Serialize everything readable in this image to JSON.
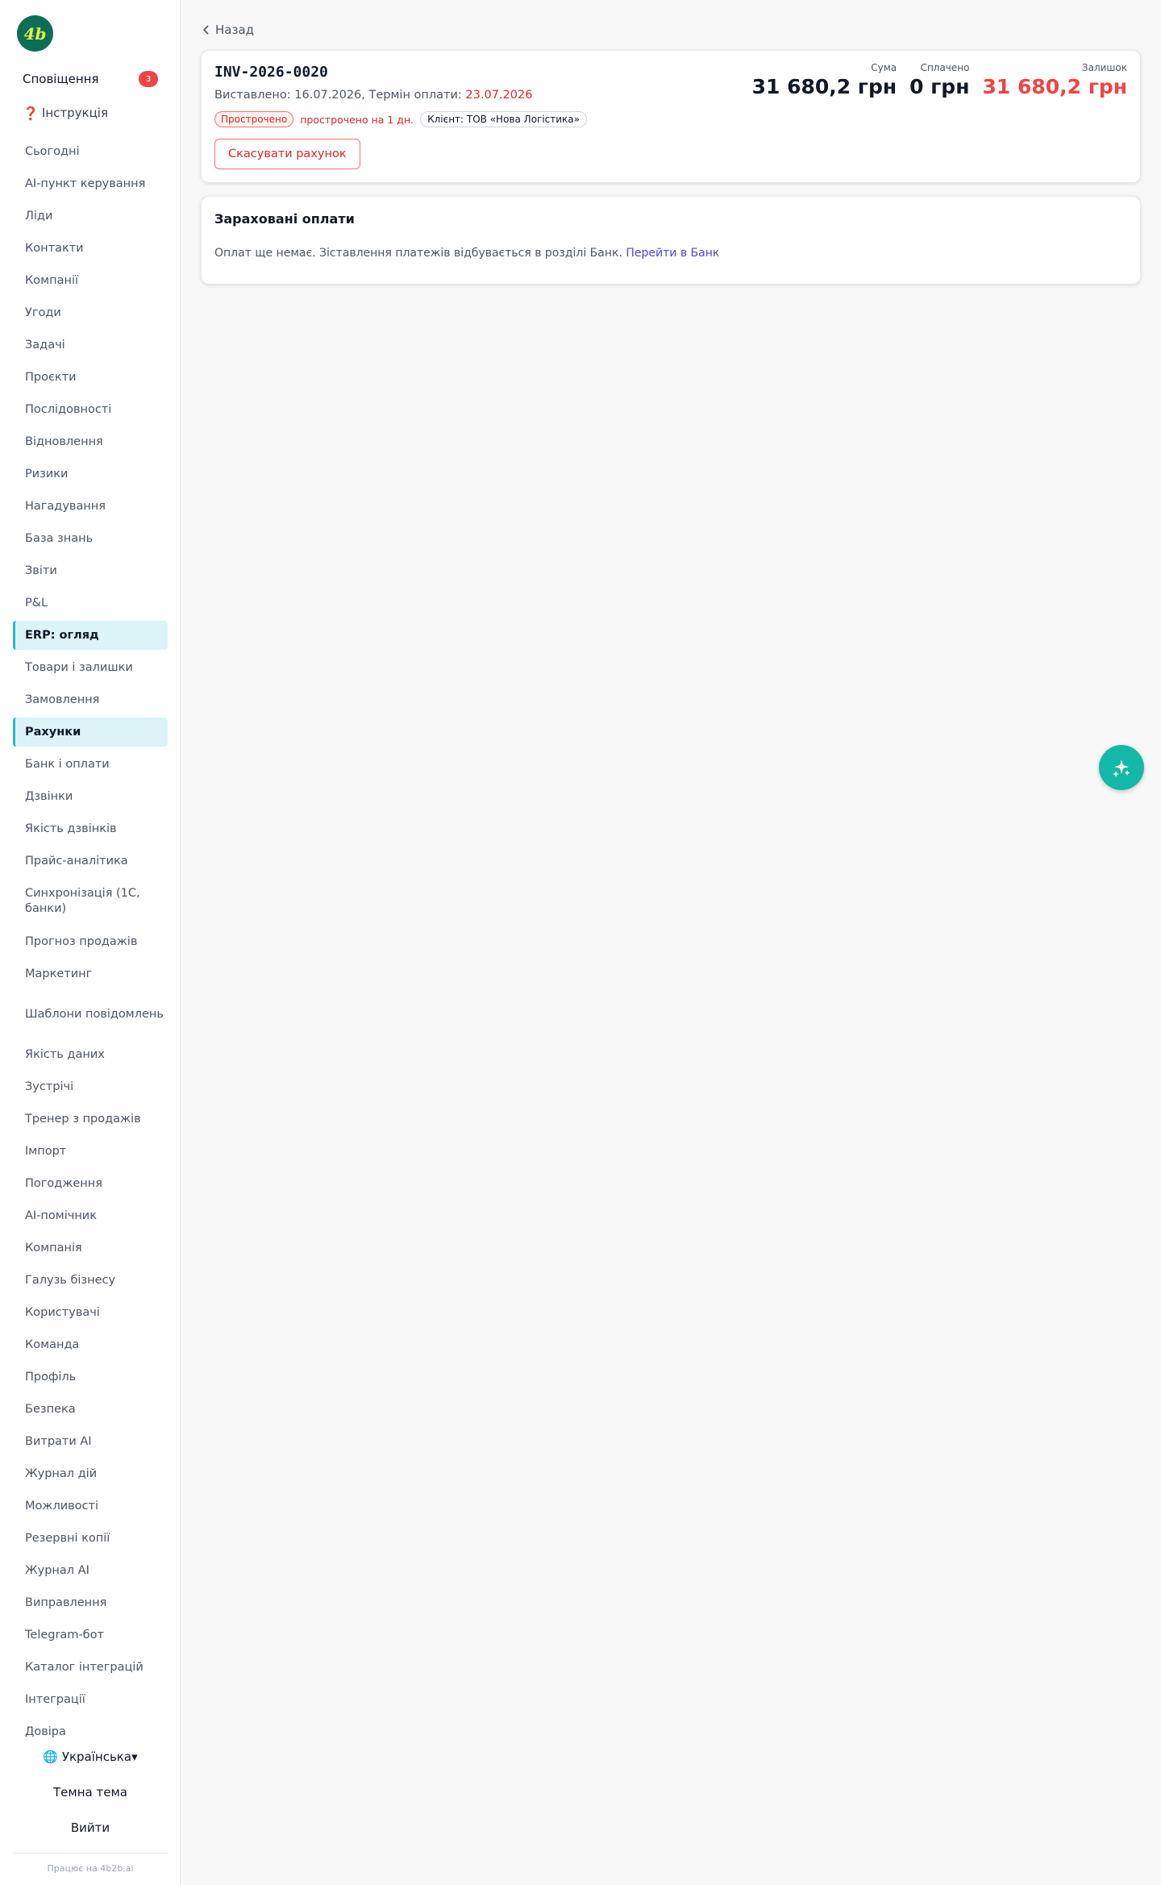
{
  "sidebar": {
    "logo_text": "4b",
    "notifications": {
      "label": "Сповіщення",
      "count": "3"
    },
    "help": {
      "icon": "❓",
      "label": "Інструкція"
    },
    "items": [
      {
        "label": "Сьогодні"
      },
      {
        "label": "AI-пункт керування"
      },
      {
        "label": "Ліди"
      },
      {
        "label": "Контакти"
      },
      {
        "label": "Компанії"
      },
      {
        "label": "Угоди"
      },
      {
        "label": "Задачі"
      },
      {
        "label": "Проєкти"
      },
      {
        "label": "Послідовності"
      },
      {
        "label": "Відновлення"
      },
      {
        "label": "Ризики"
      },
      {
        "label": "Нагадування"
      },
      {
        "label": "База знань"
      },
      {
        "label": "Звіти"
      },
      {
        "label": "P&L"
      },
      {
        "label": "ERP: огляд",
        "active": true
      },
      {
        "label": "Товари і залишки"
      },
      {
        "label": "Замовлення"
      },
      {
        "label": "Рахунки",
        "active": true
      },
      {
        "label": "Банк і оплати"
      },
      {
        "label": "Дзвінки"
      },
      {
        "label": "Якість дзвінків"
      },
      {
        "label": "Прайс-аналітика"
      },
      {
        "label": "Синхронізація (1С, банки)"
      },
      {
        "label": "Прогноз продажів"
      },
      {
        "label": "Маркетинг"
      },
      {
        "label": "Шаблони повідомлень"
      },
      {
        "label": "Якість даних"
      },
      {
        "label": "Зустрічі"
      },
      {
        "label": "Тренер з продажів"
      },
      {
        "label": "Імпорт"
      },
      {
        "label": "Погодження"
      },
      {
        "label": "AI-помічник"
      },
      {
        "label": "Компанія"
      },
      {
        "label": "Галузь бізнесу"
      },
      {
        "label": "Користувачі"
      },
      {
        "label": "Команда"
      },
      {
        "label": "Профіль"
      },
      {
        "label": "Безпека"
      },
      {
        "label": "Витрати AI"
      },
      {
        "label": "Журнал дій"
      },
      {
        "label": "Можливості"
      },
      {
        "label": "Резервні копії"
      },
      {
        "label": "Журнал AI"
      },
      {
        "label": "Виправлення"
      },
      {
        "label": "Telegram-бот"
      },
      {
        "label": "Каталог інтеграцій"
      },
      {
        "label": "Інтеграції"
      },
      {
        "label": "Довіра"
      }
    ],
    "language": "🌐 Українська▾",
    "theme_label": "Темна тема",
    "logout_label": "Вийти",
    "footer": "Працює на 4b2b.ai"
  },
  "main": {
    "back_label": "Назад",
    "invoice": {
      "number": "INV-2026-0020",
      "issued_prefix": "Виставлено: 16.07.2026, Термін оплати: ",
      "due_date": "23.07.2026",
      "status_badge": "Прострочено",
      "overdue_text": "прострочено на 1 дн.",
      "client": "Клієнт: ТОВ «Нова Логістика»",
      "cancel_label": "Скасувати рахунок",
      "totals": {
        "sum_label": "Сума",
        "sum_value": "31 680,2 грн",
        "paid_label": "Сплачено",
        "paid_value": "0 грн",
        "rest_label": "Залишок",
        "rest_value": "31 680,2 грн"
      }
    },
    "payments": {
      "title": "Зараховані оплати",
      "empty_text": "Оплат ще немає. Зіставлення платежів відбувається в розділі Банк. ",
      "link_label": "Перейти в Банк"
    }
  },
  "colors": {
    "accent": "#22b8d6",
    "danger": "#ef4444",
    "link": "#4f46e5",
    "fab": "#14b8a6",
    "logo_bg": "#0d6e57"
  }
}
